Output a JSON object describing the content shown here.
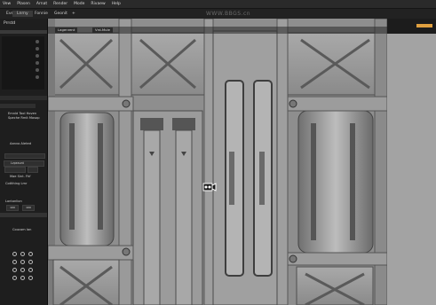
{
  "menubar": {
    "items": [
      "Vew",
      "Plasen",
      "Arnat",
      "Render",
      "Mode",
      "Rivaew",
      "Help"
    ]
  },
  "tabs": {
    "items": [
      "Evedt",
      "Lnrny",
      "Fonnie",
      "Geonit"
    ]
  },
  "watermark": "WWW.BBGS.cn",
  "left_panel": {
    "title": "Prrstd",
    "options": [
      "Emnld Tool Hoven",
      "Speche Rmit Mosop"
    ],
    "auto_option": "Aanvo Aleted",
    "sections": [
      "Lvpeaunt",
      "Mae Sint. Fhf",
      "Cotlthing Lmr"
    ],
    "sub_label": "Lontonlion",
    "values": [
      "100",
      "100"
    ],
    "icon_group_label": "Coucom Ian"
  },
  "viewport": {
    "shading_dropdown": "Lagenrent",
    "view_label": "Vrd-Mule",
    "camera_icon": "camera-icon"
  },
  "colors": {
    "accent": "#e0a040",
    "viewport_bg": "#8d8d8d"
  }
}
